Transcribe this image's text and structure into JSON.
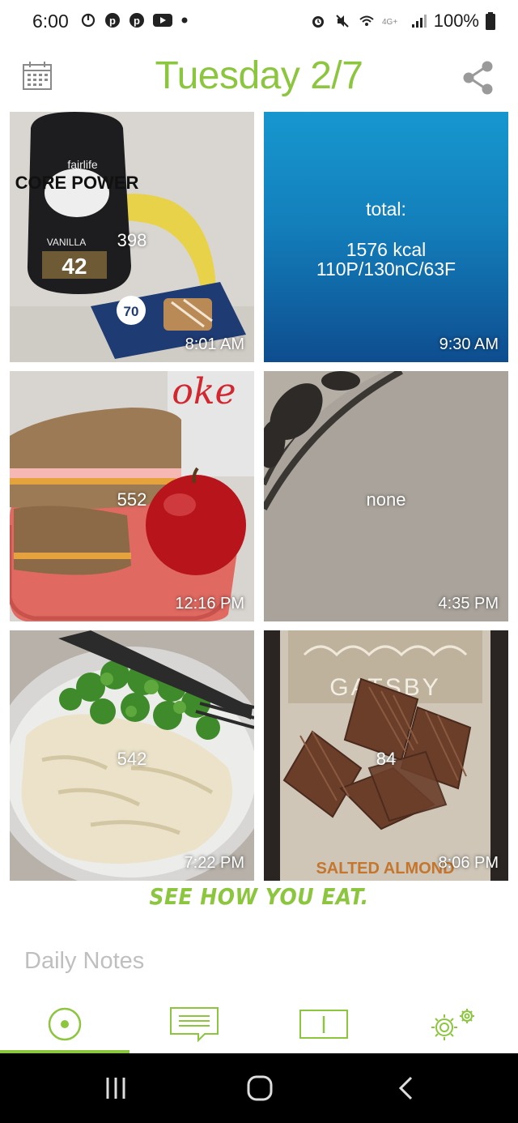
{
  "status_bar": {
    "time": "6:00",
    "left_icons": [
      "sync-icon",
      "pinterest-icon",
      "pinterest-icon",
      "youtube-icon",
      "dot-icon"
    ],
    "right_icons": [
      "alarm-icon",
      "mute-icon",
      "wifi-icon",
      "lte-icon",
      "signal-icon"
    ],
    "battery": "100%"
  },
  "header": {
    "title": "Tuesday 2/7",
    "calendar_icon": "calendar-icon",
    "share_icon": "share-icon"
  },
  "meals": [
    {
      "kcal": "398",
      "time": "8:01 AM",
      "image": "protein shake, banana and snack bar"
    },
    {
      "total_label": "total:",
      "total_kcal": "1576 kcal",
      "macros": "110P/130nC/63F",
      "time": "9:30 AM"
    },
    {
      "kcal": "552",
      "time": "12:16 PM",
      "image": "sandwich, apple and soda can"
    },
    {
      "kcal": "none",
      "time": "4:35 PM",
      "image": "blank cardboard surface"
    },
    {
      "kcal": "542",
      "time": "7:22 PM",
      "image": "pasta with broccoli"
    },
    {
      "kcal": "84",
      "time": "8:06 PM",
      "image": "chocolate squares"
    }
  ],
  "photo_text": {
    "brand": "fairlife",
    "product": "CORE POWER",
    "flavor": "VANILLA",
    "protein": "42",
    "bar_calories": "70",
    "can": "oke",
    "choc_brand": "GATSBY",
    "choc_flavor": "SALTED ALMOND"
  },
  "tagline": "SEE HOW YOU EAT.",
  "notes_placeholder": "Daily Notes",
  "bottom_nav": [
    "today-icon",
    "notes-icon",
    "info-icon",
    "settings-icon"
  ],
  "colors": {
    "accent": "#8cc63f",
    "notes_gray": "#bfbfbf"
  }
}
